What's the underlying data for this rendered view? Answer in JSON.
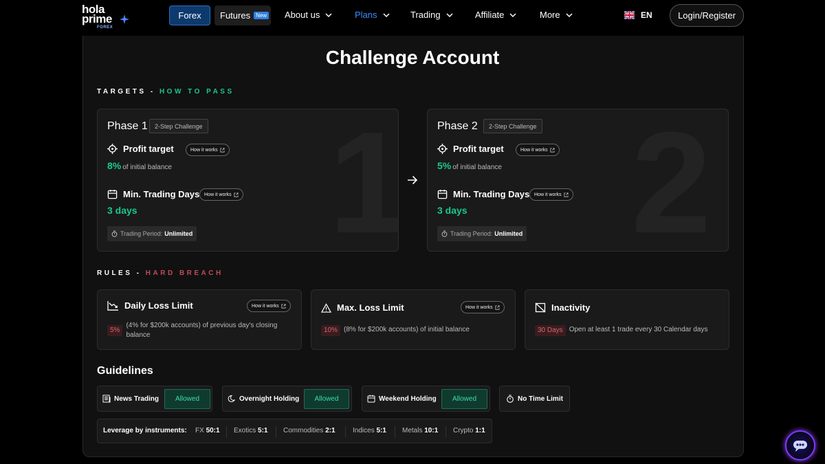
{
  "nav": {
    "logo_line1": "hola",
    "logo_line2": "prime",
    "logo_sub": "FOREX",
    "forex": "Forex",
    "futures": "Futures",
    "futures_badge": "New",
    "about": "About us",
    "plans": "Plans",
    "trading": "Trading",
    "affiliate": "Affiliate",
    "more": "More",
    "lang": "EN",
    "login": "Login/Register"
  },
  "title": "Challenge Account",
  "targets": {
    "label": "TARGETS - ",
    "accent": "HOW TO PASS",
    "phases": [
      {
        "title": "Phase 1",
        "tag": "2-Step Challenge",
        "num": "1",
        "profit_label": "Profit target",
        "profit_value": "8%",
        "profit_sub": "of initial balance",
        "days_label": "Min. Trading Days",
        "days_value": "3 days",
        "period_label": "Trading Period:",
        "period_value": "Unlimited",
        "how": "How it works"
      },
      {
        "title": "Phase 2",
        "tag": "2-Step Challenge",
        "num": "2",
        "profit_label": "Profit target",
        "profit_value": "5%",
        "profit_sub": "of initial balance",
        "days_label": "Min. Trading Days",
        "days_value": "3 days",
        "period_label": "Trading Period:",
        "period_value": "Unlimited",
        "how": "How it works"
      }
    ]
  },
  "rules": {
    "label": "RULES - ",
    "accent": "HARD BREACH",
    "items": [
      {
        "title": "Daily Loss Limit",
        "badge": "5%",
        "desc": "(4% for $200k accounts) of previous day's closing balance",
        "how": "How it works"
      },
      {
        "title": "Max. Loss Limit",
        "badge": "10%",
        "desc": "(8% for $200k accounts) of initial balance",
        "how": "How it works"
      },
      {
        "title": "Inactivity",
        "badge": "30 Days",
        "desc": "Open at least 1 trade every 30 Calendar days"
      }
    ]
  },
  "guidelines": {
    "title": "Guidelines",
    "items": [
      {
        "label": "News Trading",
        "status": "Allowed"
      },
      {
        "label": "Overnight Holding",
        "status": "Allowed"
      },
      {
        "label": "Weekend Holding",
        "status": "Allowed"
      },
      {
        "label": "No Time Limit"
      }
    ],
    "leverage_label": "Leverage by instruments:",
    "leverage": [
      {
        "name": "FX",
        "ratio": "50:1"
      },
      {
        "name": "Exotics",
        "ratio": "5:1"
      },
      {
        "name": "Commodities",
        "ratio": "2:1"
      },
      {
        "name": "Indices",
        "ratio": "5:1"
      },
      {
        "name": "Metals",
        "ratio": "10:1"
      },
      {
        "name": "Crypto",
        "ratio": "1:1"
      }
    ]
  },
  "colors": {
    "accent_green": "#19c98b",
    "accent_red": "#c04a5a",
    "nav_blue": "#3b8cff"
  }
}
